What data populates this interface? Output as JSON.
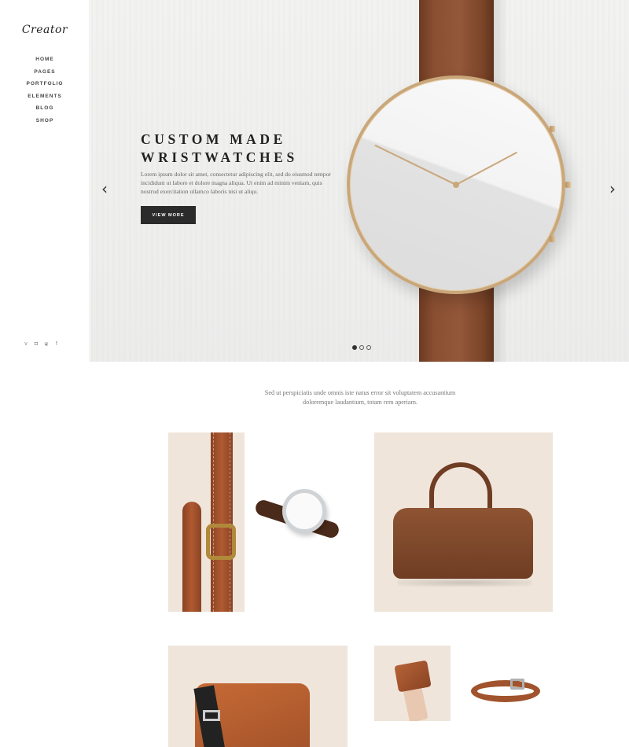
{
  "sidebar": {
    "logo": "Creator",
    "nav": [
      "HOME",
      "PAGES",
      "PORTFOLIO",
      "ELEMENTS",
      "BLOG",
      "SHOP"
    ],
    "social": [
      {
        "icon": "vimeo-icon",
        "glyph": "v"
      },
      {
        "icon": "instagram-icon",
        "glyph": "◘"
      },
      {
        "icon": "twitter-icon",
        "glyph": "❦"
      },
      {
        "icon": "facebook-icon",
        "glyph": "f"
      }
    ]
  },
  "hero": {
    "title_line1": "CUSTOM MADE",
    "title_line2": "WRISTWATCHES",
    "text": "Lorem ipsum dolor sit amet, consectetur adipiscing elit, sed do eiusmod tempor incididunt ut labore et dolore magna aliqua. Ut enim ad minim veniam, quis nostrud exercitation ullamco laboris nisi ut aliqu.",
    "button": "VIEW MORE",
    "prev_arrow": "‹",
    "next_arrow": "›",
    "slides": 3,
    "active_slide": 1
  },
  "intro": {
    "line1": "Sed ut perspiciatis unde omnis iste natus error sit voluptatem accusantium",
    "line2": "doloremque laudantium, totam rem aperiam."
  },
  "colors": {
    "accent_dark": "#2b2b2b",
    "leather": "#8a4f31",
    "gold": "#c9a77a",
    "tile_bg": "#efe5db"
  }
}
